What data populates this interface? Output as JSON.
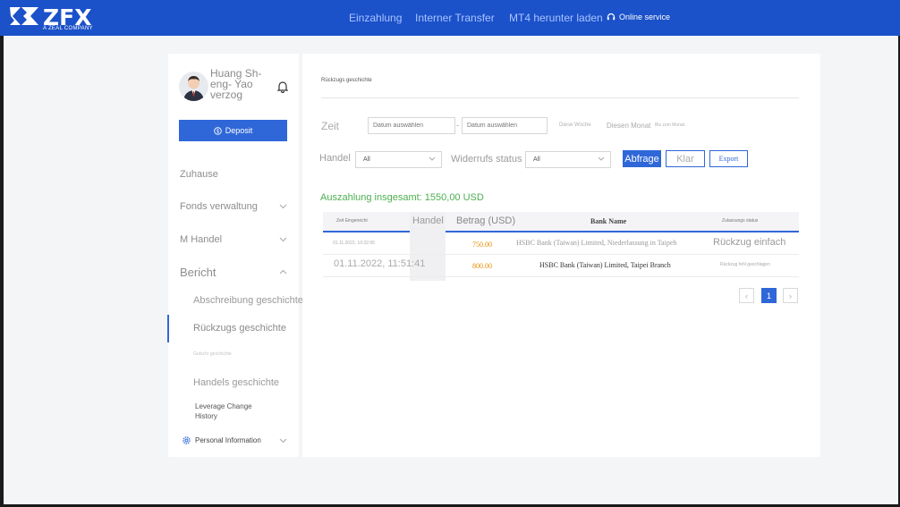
{
  "header": {
    "logo_text": "ZFX",
    "logo_sub": "A ZEAL COMPANY",
    "nav": [
      "Einzahlung",
      "Interner Transfer",
      "MT4 herunter laden"
    ],
    "service_label": "Online service"
  },
  "sidebar": {
    "user_name": "Huang Sh-eng- Yao verzog",
    "deposit_label": "Deposit",
    "menu": {
      "home": "Zuhause",
      "funds": "Fonds verwaltung",
      "trade": "M Handel",
      "report": "Bericht"
    },
    "submenu": {
      "write_off": "Abschreibung geschichte",
      "withdrawal": "Rückzugs geschichte",
      "deposit_hist": "Gutschr geschichte",
      "trade_hist": "Handels geschichte",
      "leverage_line1": "Leverage Change",
      "leverage_line2": "History"
    },
    "personal_info": "Personal Information"
  },
  "main": {
    "page_title": "Rückzugs geschichte",
    "filters": {
      "time_label": "Zeit",
      "date_placeholder_1": "Datum auswählen",
      "date_placeholder_2": "Datum auswählen",
      "this_week": "Diese Woche",
      "this_month": "Diesen Monat",
      "last_month": "Bis zum Monat",
      "handel_label": "Handel",
      "handel_value": "All",
      "status_label": "Widerrufs status",
      "status_value": "All",
      "query_button": "Abfrage",
      "clear_button": "Klar",
      "export_button": "Export"
    },
    "total_label": "Auszahlung insgesamt: 1550,00 USD",
    "table": {
      "headers": [
        "Zeit Eingereicht",
        "Handel",
        "Betrag (USD)",
        "Bank Name",
        "Zulassungs status"
      ],
      "rows": [
        {
          "time": "01.11.2022, 10:32:06",
          "amount": "750.00",
          "bank": "HSBC Bank (Taiwan) Limited, Niederlassung in Taipeh",
          "status": "Rückzug einfach"
        },
        {
          "time": "01.11.2022, 11:51:41",
          "amount": "800.00",
          "bank": "HSBC Bank (Taiwan) Limited, Taipei Branch",
          "status": "Rückzug fehl geschlagen"
        }
      ]
    },
    "pagination": {
      "prev": "‹",
      "current": "1",
      "next": "›"
    }
  },
  "colors": {
    "brand": "#1b51c9",
    "primary_button": "#2f67d8",
    "total_green": "#4caf50",
    "amount_orange": "#e68a00"
  }
}
